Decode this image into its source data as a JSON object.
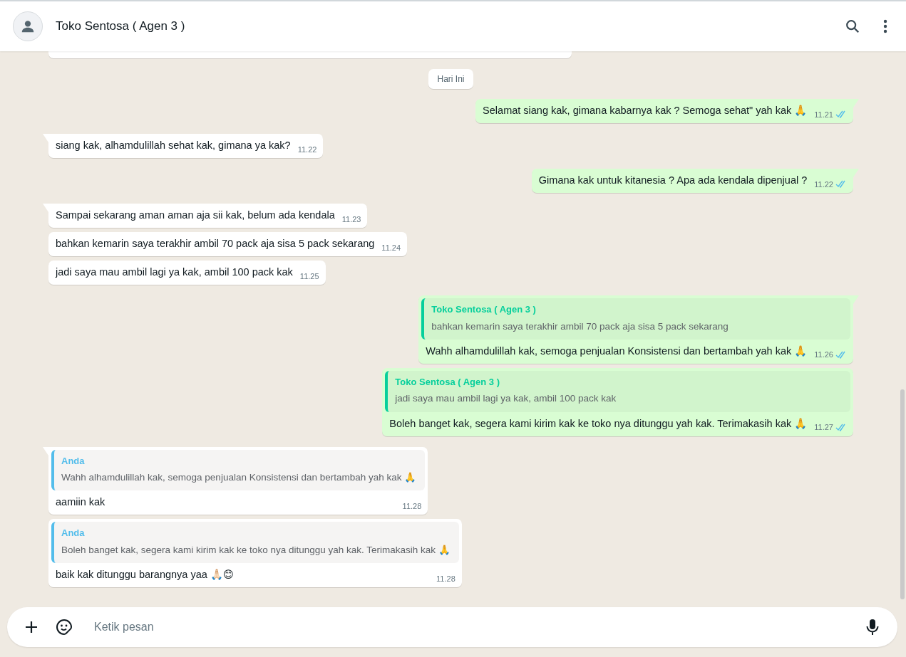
{
  "header": {
    "title": "Toko Sentosa ( Agen 3 )"
  },
  "date_divider": "Hari Ini",
  "messages": [
    {
      "outgoing": true,
      "tail": true,
      "text": "Selamat  siang kak, gimana kabarnya kak ? Semoga sehat\" yah kak 🙏",
      "time": "11.21",
      "read": true
    },
    {
      "outgoing": false,
      "tail": true,
      "text": "siang kak, alhamdulillah sehat kak, gimana ya kak?",
      "time": "11.22"
    },
    {
      "outgoing": true,
      "tail": true,
      "text": "Gimana kak untuk kitanesia ? Apa ada kendala dipenjual  ?",
      "time": "11.22",
      "read": true
    },
    {
      "outgoing": false,
      "tail": true,
      "text": "Sampai sekarang aman aman aja sii kak, belum ada kendala",
      "time": "11.23"
    },
    {
      "outgoing": false,
      "tail": false,
      "text": "bahkan kemarin saya terakhir ambil 70 pack aja sisa 5 pack sekarang",
      "time": "11.24"
    },
    {
      "outgoing": false,
      "tail": false,
      "text": "jadi saya mau ambil lagi ya kak, ambil 100 pack kak",
      "time": "11.25"
    },
    {
      "outgoing": true,
      "tail": true,
      "quote": {
        "author": "Toko Sentosa ( Agen 3 )",
        "text": "bahkan kemarin saya terakhir ambil 70 pack aja sisa 5 pack sekarang",
        "color": "#06cf9c"
      },
      "text": "Wahh alhamdulillah kak, semoga penjualan Konsistensi dan bertambah yah kak 🙏",
      "time": "11.26",
      "read": true
    },
    {
      "outgoing": true,
      "tail": false,
      "quote": {
        "author": "Toko Sentosa ( Agen 3 )",
        "text": "jadi saya mau ambil lagi ya kak, ambil 100 pack kak",
        "color": "#06cf9c"
      },
      "text": "Boleh banget kak, segera kami kirim kak ke toko nya ditunggu yah kak. Terimakasih kak 🙏",
      "time": "11.27",
      "read": true
    },
    {
      "outgoing": false,
      "tail": true,
      "quote": {
        "author": "Anda",
        "text": "Wahh alhamdulillah kak, semoga penjualan Konsistensi dan bertambah yah kak 🙏",
        "color": "#53bdeb"
      },
      "text": "aamiin kak",
      "time": "11.28"
    },
    {
      "outgoing": false,
      "tail": false,
      "quote": {
        "author": "Anda",
        "text": "Boleh banget kak, segera kami kirim kak ke toko nya ditunggu yah kak. Terimakasih kak 🙏",
        "color": "#53bdeb"
      },
      "text": "baik kak ditunggu barangnya yaa 🙏🏻😊",
      "time": "11.28"
    }
  ],
  "composer": {
    "placeholder": "Ketik pesan"
  }
}
